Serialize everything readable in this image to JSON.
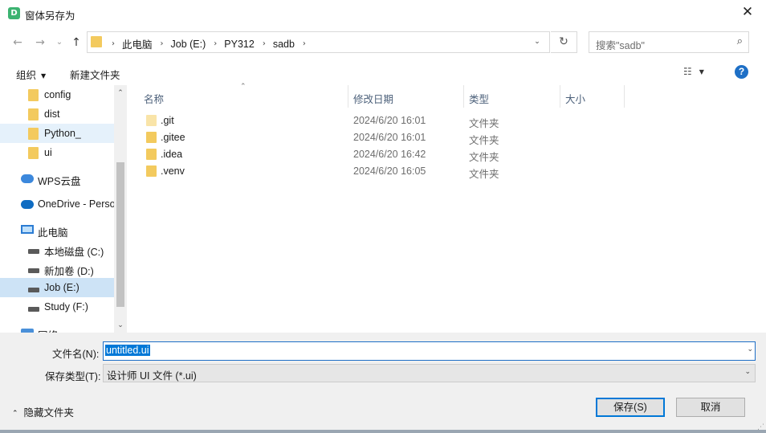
{
  "window": {
    "app_icon_letter": "D",
    "title": "窗体另存为",
    "close_glyph": "✕"
  },
  "navigation": {
    "back_glyph": "←",
    "forward_glyph": "→",
    "history_glyph": "⌄",
    "up_glyph": "↑"
  },
  "address": {
    "crumbs": [
      "此电脑",
      "Job (E:)",
      "PY312",
      "sadb"
    ],
    "separator": "›",
    "dropdown_glyph": "⌄",
    "refresh_glyph": "↻"
  },
  "search": {
    "placeholder": "搜索\"sadb\"",
    "icon_glyph": "⌕"
  },
  "toolbar": {
    "organize": "组织",
    "new_folder": "新建文件夹",
    "view_glyph": "☷",
    "caret": "▼",
    "help": "?"
  },
  "sidebar": {
    "items": [
      {
        "label": "config",
        "icon": "folder-icon"
      },
      {
        "label": "dist",
        "icon": "folder-icon"
      },
      {
        "label": "Python_",
        "icon": "folder-icon"
      },
      {
        "label": "ui",
        "icon": "folder-icon"
      },
      {
        "label": "WPS云盘",
        "icon": "cloud-icon"
      },
      {
        "label": "OneDrive - Perso",
        "icon": "onedrive-icon"
      },
      {
        "label": "此电脑",
        "icon": "computer-icon"
      },
      {
        "label": "本地磁盘 (C:)",
        "icon": "drive-icon"
      },
      {
        "label": "新加卷 (D:)",
        "icon": "drive-icon"
      },
      {
        "label": "Job (E:)",
        "icon": "drive-icon"
      },
      {
        "label": "Study (F:)",
        "icon": "drive-icon"
      },
      {
        "label": "网络",
        "icon": "network-icon"
      }
    ],
    "scroll_up": "⌃",
    "scroll_down": "⌄"
  },
  "file_list": {
    "columns": [
      "名称",
      "修改日期",
      "类型",
      "大小"
    ],
    "sort_glyph": "⌃",
    "rows": [
      {
        "name": ".git",
        "modified": "2024/6/20 16:01",
        "type": "文件夹",
        "size": ""
      },
      {
        "name": ".gitee",
        "modified": "2024/6/20 16:01",
        "type": "文件夹",
        "size": ""
      },
      {
        "name": ".idea",
        "modified": "2024/6/20 16:42",
        "type": "文件夹",
        "size": ""
      },
      {
        "name": ".venv",
        "modified": "2024/6/20 16:05",
        "type": "文件夹",
        "size": ""
      }
    ]
  },
  "form": {
    "filename_label": "文件名(N):",
    "filename_value": "untitled.ui",
    "filetype_label": "保存类型(T):",
    "filetype_value": "设计师 UI 文件 (*.ui)",
    "dropdown_glyph": "⌄"
  },
  "footer": {
    "hide_folders": "隐藏文件夹",
    "hide_chevron": "⌃",
    "save_label": "保存(S)",
    "cancel_label": "取消",
    "grip_glyph": "⋰"
  },
  "colors": {
    "accent": "#0078d7",
    "folder": "#f3ca5e",
    "selected_bg": "#cde3f6",
    "help": "#1e6fc6"
  }
}
